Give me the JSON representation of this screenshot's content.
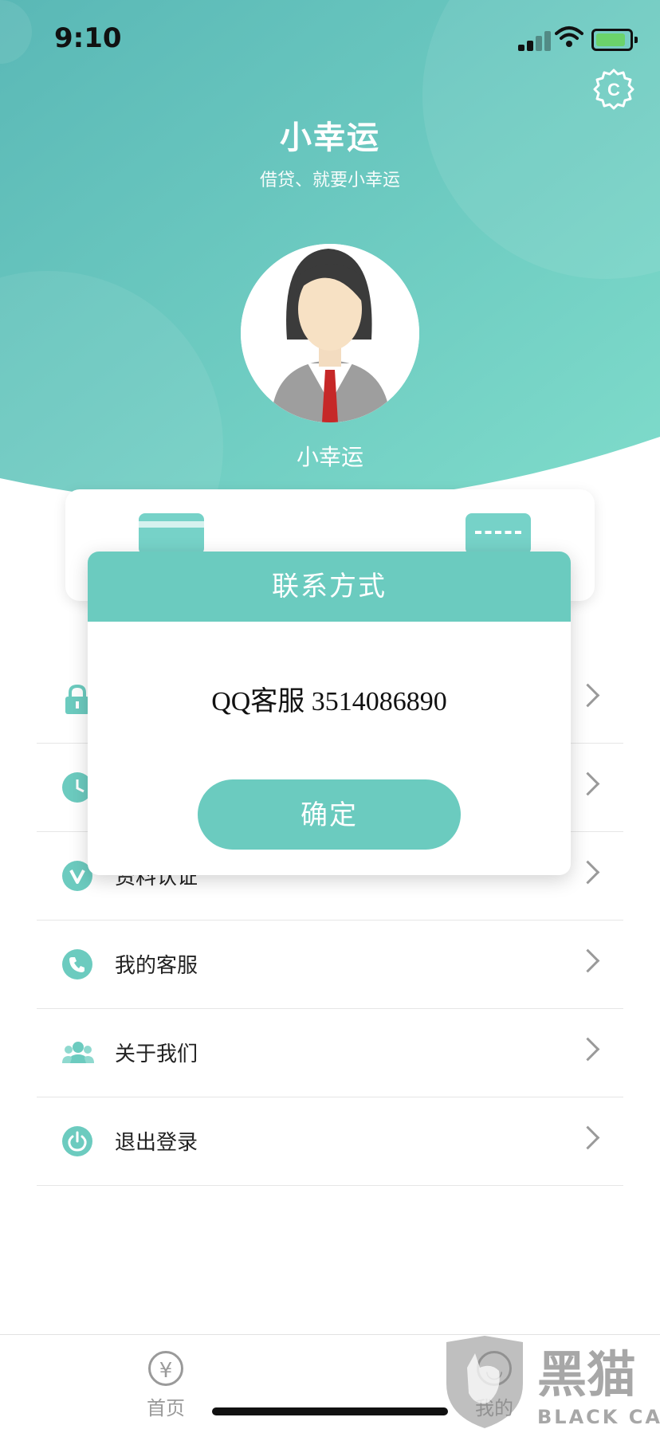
{
  "status_bar": {
    "time": "9:10"
  },
  "header": {
    "title": "小幸运",
    "subtitle": "借贷、就要小幸运",
    "username": "小幸运"
  },
  "menu": {
    "items": [
      {
        "label": "",
        "icon": "lock-icon"
      },
      {
        "label": "",
        "icon": "clock-icon"
      },
      {
        "label": "资料认证",
        "icon": "v-badge-icon"
      },
      {
        "label": "我的客服",
        "icon": "phone-icon"
      },
      {
        "label": "关于我们",
        "icon": "people-icon"
      },
      {
        "label": "退出登录",
        "icon": "power-icon"
      }
    ]
  },
  "tabbar": {
    "tabs": [
      {
        "label": "首页",
        "icon": "yen-icon"
      },
      {
        "label": "我的",
        "icon": "user-icon"
      }
    ]
  },
  "dialog": {
    "title": "联系方式",
    "message": "QQ客服 3514086890",
    "confirm_label": "确定"
  },
  "watermark": {
    "text_cn": "黑猫",
    "text_en": "BLACK CAT"
  },
  "colors": {
    "accent": "#6bcbbf",
    "header_gradient_start": "#5cbcb8",
    "header_gradient_end": "#7ad8c8"
  }
}
